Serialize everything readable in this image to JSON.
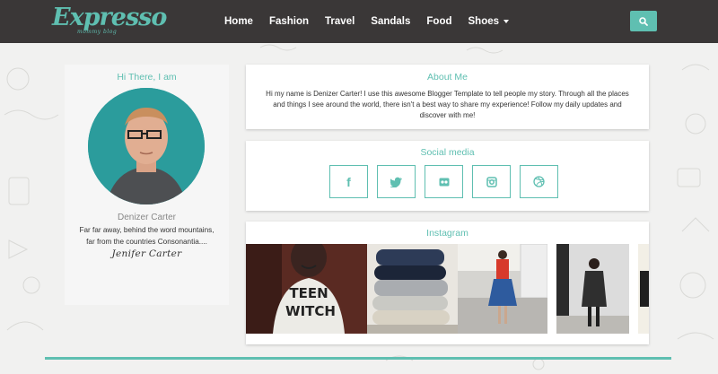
{
  "header": {
    "logo": "Expresso",
    "tagline": "mommy blog",
    "nav": [
      {
        "label": "Home"
      },
      {
        "label": "Fashion"
      },
      {
        "label": "Travel"
      },
      {
        "label": "Sandals"
      },
      {
        "label": "Food"
      },
      {
        "label": "Shoes",
        "has_dropdown": true
      }
    ],
    "search_icon": "search-icon"
  },
  "profile": {
    "greeting": "Hi There, I am",
    "name": "Denizer Carter",
    "bio_line1": "Far far away, behind the word mountains,",
    "bio_line2": "far from the countries Consonantia....",
    "signature": "Jenifer Carter"
  },
  "about": {
    "title": "About Me",
    "text": "Hi my name is Denizer Carter! I use this awesome Blogger Template to tell people my story. Through all the places and things I see around the world, there isn't a best way to share my experience! Follow my daily updates and discover with me!"
  },
  "social": {
    "title": "Social media",
    "icons": [
      {
        "name": "facebook-icon",
        "glyph": "f"
      },
      {
        "name": "twitter-icon",
        "glyph": "t"
      },
      {
        "name": "flickr-icon",
        "glyph": "••"
      },
      {
        "name": "instagram-icon",
        "glyph": ""
      },
      {
        "name": "dribbble-icon",
        "glyph": ""
      }
    ]
  },
  "instagram": {
    "title": "Instagram",
    "photo_printed_text": [
      "TEEN",
      "WITCH"
    ]
  },
  "colors": {
    "accent": "#5fbfb1",
    "header_bg": "#3a3737",
    "page_bg": "#f1f1f0"
  }
}
